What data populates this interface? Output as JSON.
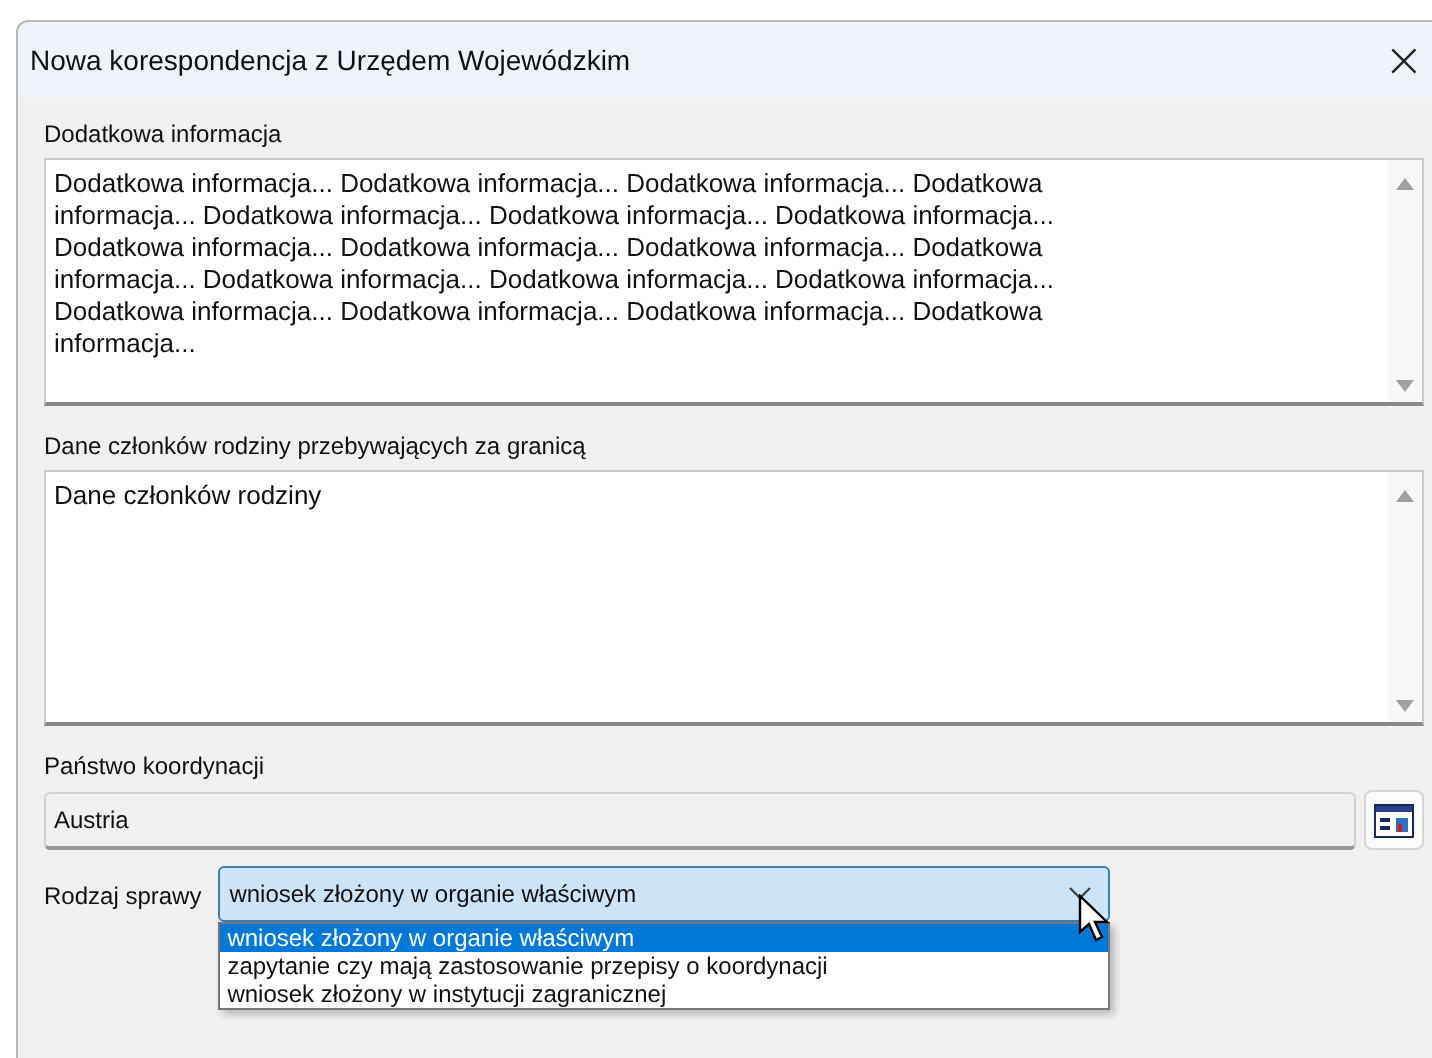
{
  "window": {
    "title": "Nowa korespondencja z Urzędem Wojewódzkim",
    "close": "×"
  },
  "fields": [
    {
      "label": "Dodatkowa informacja",
      "value": "Dodatkowa informacja... Dodatkowa informacja... Dodatkowa informacja... Dodatkowa informacja... Dodatkowa informacja... Dodatkowa informacja... Dodatkowa informacja... Dodatkowa informacja... Dodatkowa informacja... Dodatkowa informacja... Dodatkowa informacja... Dodatkowa informacja... Dodatkowa informacja... Dodatkowa informacja... Dodatkowa informacja... Dodatkowa informacja... Dodatkowa informacja... Dodatkowa informacja..."
    },
    {
      "label": "Dane członków rodziny przebywających za granicą",
      "value": "Dane członków rodziny"
    }
  ],
  "country": {
    "label": "Państwo koordynacji",
    "value": "Austria"
  },
  "case_type": {
    "label": "Rodzaj sprawy",
    "value": "wniosek złożony w organie właściwym",
    "expanded": true,
    "options": [
      {
        "label": "wniosek złożony w organie właściwym",
        "selected": true
      },
      {
        "label": "zapytanie czy mają zastosowanie przepisy o koordynacji",
        "selected": false
      },
      {
        "label": "wniosek złożony w instytucji zagranicznej",
        "selected": false
      }
    ]
  }
}
